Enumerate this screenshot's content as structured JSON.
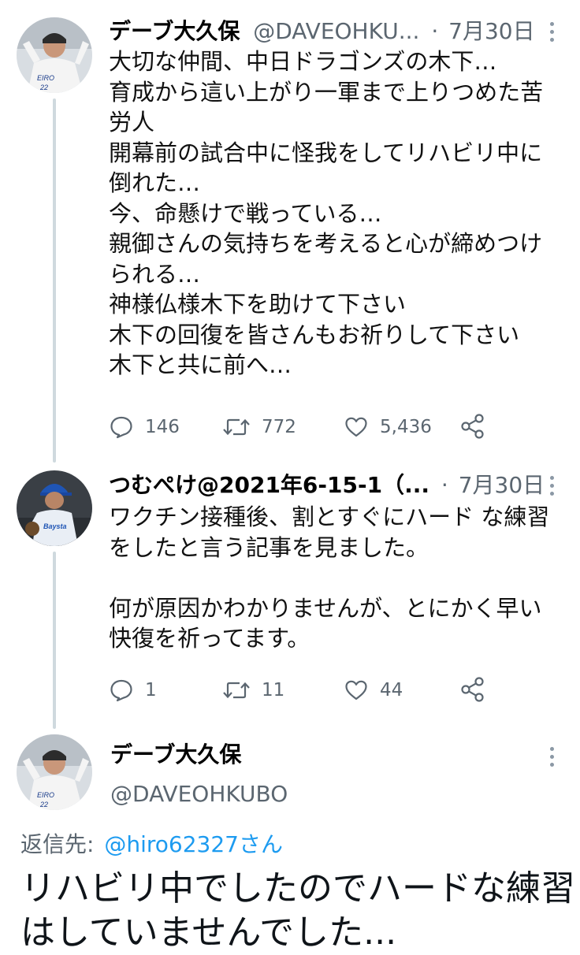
{
  "tweets": [
    {
      "display_name": "デーブ大久保",
      "handle": "@DAVEOHKU...",
      "separator": "·",
      "date": "7月30日",
      "body_lines": [
        "大切な仲間、中日ドラゴンズの木下…",
        "育成から這い上がり一軍まで上りつめた苦",
        "労人",
        "開幕前の試合中に怪我をしてリハビリ中に",
        "倒れた…",
        "今、命懸けで戦っている…",
        "親御さんの気持ちを考えると心が締めつけ",
        "られる…",
        "神様仏様木下を助けて下さい",
        "木下の回復を皆さんもお祈りして下さい",
        "木下と共に前へ…"
      ],
      "reply_count": "146",
      "retweet_count": "772",
      "like_count": "5,436",
      "avatar_jersey": "22",
      "avatar_text": "EIRO"
    },
    {
      "display_name": "つむぺけ@2021年6-15-1（...",
      "separator": "·",
      "date": "7月30日",
      "body_lines": [
        "ワクチン接種後、割とすぐにハード な練習",
        "をしたと言う記事を見ました。",
        "",
        "何が原因かわかりませんが、とにかく早い",
        "快復を祈ってます。"
      ],
      "reply_count": "1",
      "retweet_count": "11",
      "like_count": "44",
      "avatar_text": "Baysta"
    }
  ],
  "main_tweet": {
    "display_name": "デーブ大久保",
    "handle": "@DAVEOHKUBO",
    "reply_label": "返信先:",
    "reply_mention": "@hiro62327さん",
    "text_lines": [
      "リハビリ中でしたのでハードな練習",
      "はしていませんでした..."
    ],
    "avatar_jersey": "22",
    "avatar_text": "EIRO"
  },
  "colors": {
    "text_primary": "#0f1419",
    "text_secondary": "#5b6670",
    "link": "#1d9bf0",
    "thread_line": "#cfd9de"
  },
  "icons": {
    "reply": "reply-bubble-icon",
    "retweet": "retweet-icon",
    "like": "heart-icon",
    "share": "share-icon",
    "more": "more-vertical-icon"
  }
}
